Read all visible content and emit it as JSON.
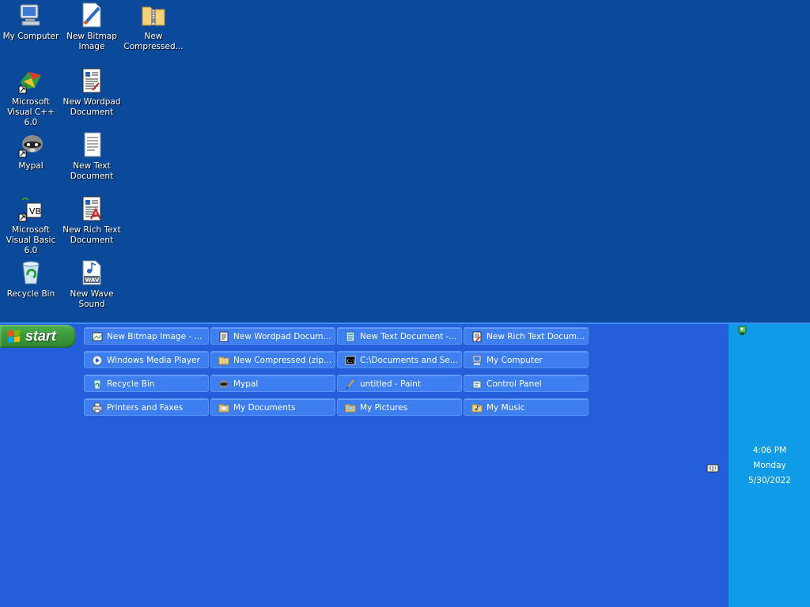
{
  "desktop_icons": [
    {
      "label": "My Computer",
      "icon": "my-computer-icon"
    },
    {
      "label": "New Bitmap Image",
      "icon": "bitmap-icon"
    },
    {
      "label": "New Compressed...",
      "icon": "zip-folder-icon"
    },
    {
      "label": "Microsoft Visual C++ 6.0",
      "icon": "visual-cpp-icon"
    },
    {
      "label": "New Wordpad Document",
      "icon": "wordpad-icon"
    },
    {
      "label": "Mypal",
      "icon": "mypal-icon"
    },
    {
      "label": "New Text Document",
      "icon": "text-document-icon"
    },
    {
      "label": "Microsoft Visual Basic 6.0",
      "icon": "visual-basic-icon"
    },
    {
      "label": "New Rich Text Document",
      "icon": "rich-text-icon"
    },
    {
      "label": "Recycle Bin",
      "icon": "recycle-bin-icon"
    },
    {
      "label": "New Wave Sound",
      "icon": "wave-sound-icon"
    }
  ],
  "start_button": {
    "label": "start"
  },
  "taskbar_buttons": [
    {
      "label": "New Bitmap Image - ...",
      "icon": "paint-icon"
    },
    {
      "label": "New Wordpad Docum...",
      "icon": "wordpad-icon"
    },
    {
      "label": "New Text Document -...",
      "icon": "notepad-icon"
    },
    {
      "label": "New Rich Text Docum...",
      "icon": "wordpad-icon"
    },
    {
      "label": "Windows Media Player",
      "icon": "media-player-icon"
    },
    {
      "label": "New Compressed (zip...",
      "icon": "zip-folder-icon"
    },
    {
      "label": "C:\\Documents and Se...",
      "icon": "cmd-icon"
    },
    {
      "label": "My Computer",
      "icon": "my-computer-icon"
    },
    {
      "label": "Recycle Bin",
      "icon": "recycle-bin-icon"
    },
    {
      "label": "Mypal",
      "icon": "mypal-icon"
    },
    {
      "label": "untitled - Paint",
      "icon": "paint-brush-icon"
    },
    {
      "label": "Control Panel",
      "icon": "control-panel-icon"
    },
    {
      "label": "Printers and Faxes",
      "icon": "printer-icon"
    },
    {
      "label": "My Documents",
      "icon": "folder-icon"
    },
    {
      "label": "My Pictures",
      "icon": "folder-icon"
    },
    {
      "label": "My Music",
      "icon": "folder-icon"
    }
  ],
  "tray": {
    "time": "4:06 PM",
    "day": "Monday",
    "date": "5/30/2022"
  },
  "colors": {
    "desktop": "#0b4a9b",
    "taskbar": "#245edb",
    "tray": "#0f9be8",
    "start": "#3c9b3a"
  }
}
